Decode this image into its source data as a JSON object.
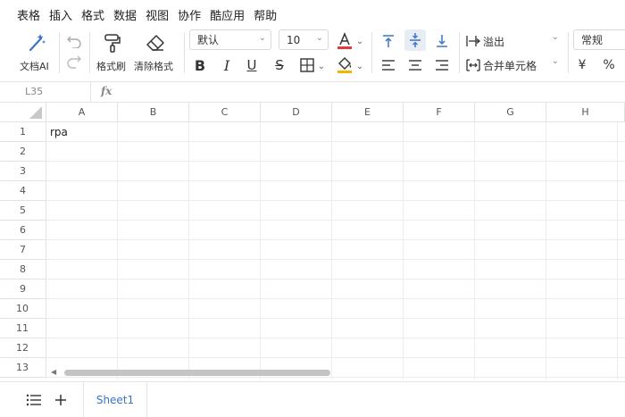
{
  "menu": {
    "items": [
      "表格",
      "插入",
      "格式",
      "数据",
      "视图",
      "协作",
      "酷应用",
      "帮助"
    ]
  },
  "toolbar": {
    "ai_label": "文档AI",
    "format_painter_label": "格式刷",
    "clear_format_label": "清除格式",
    "font_name": "默认",
    "font_size": "10",
    "overflow_label": "溢出",
    "merge_label": "合并单元格",
    "number_format": "常规",
    "currency_symbol": "¥",
    "percent_symbol": "%",
    "accent_color": "#e03c3c",
    "fill_color": "#f5b400",
    "active_icon_color": "#3b73c8"
  },
  "formula_bar": {
    "cell_ref": "L35",
    "fx_label": "fx",
    "value": ""
  },
  "grid": {
    "columns": [
      "A",
      "B",
      "C",
      "D",
      "E",
      "F",
      "G",
      "H"
    ],
    "rows": [
      "1",
      "2",
      "3",
      "4",
      "5",
      "6",
      "7",
      "8",
      "9",
      "10",
      "11",
      "12",
      "13"
    ],
    "cells": {
      "A1": "rpa"
    }
  },
  "sheets": {
    "active": "Sheet1"
  }
}
